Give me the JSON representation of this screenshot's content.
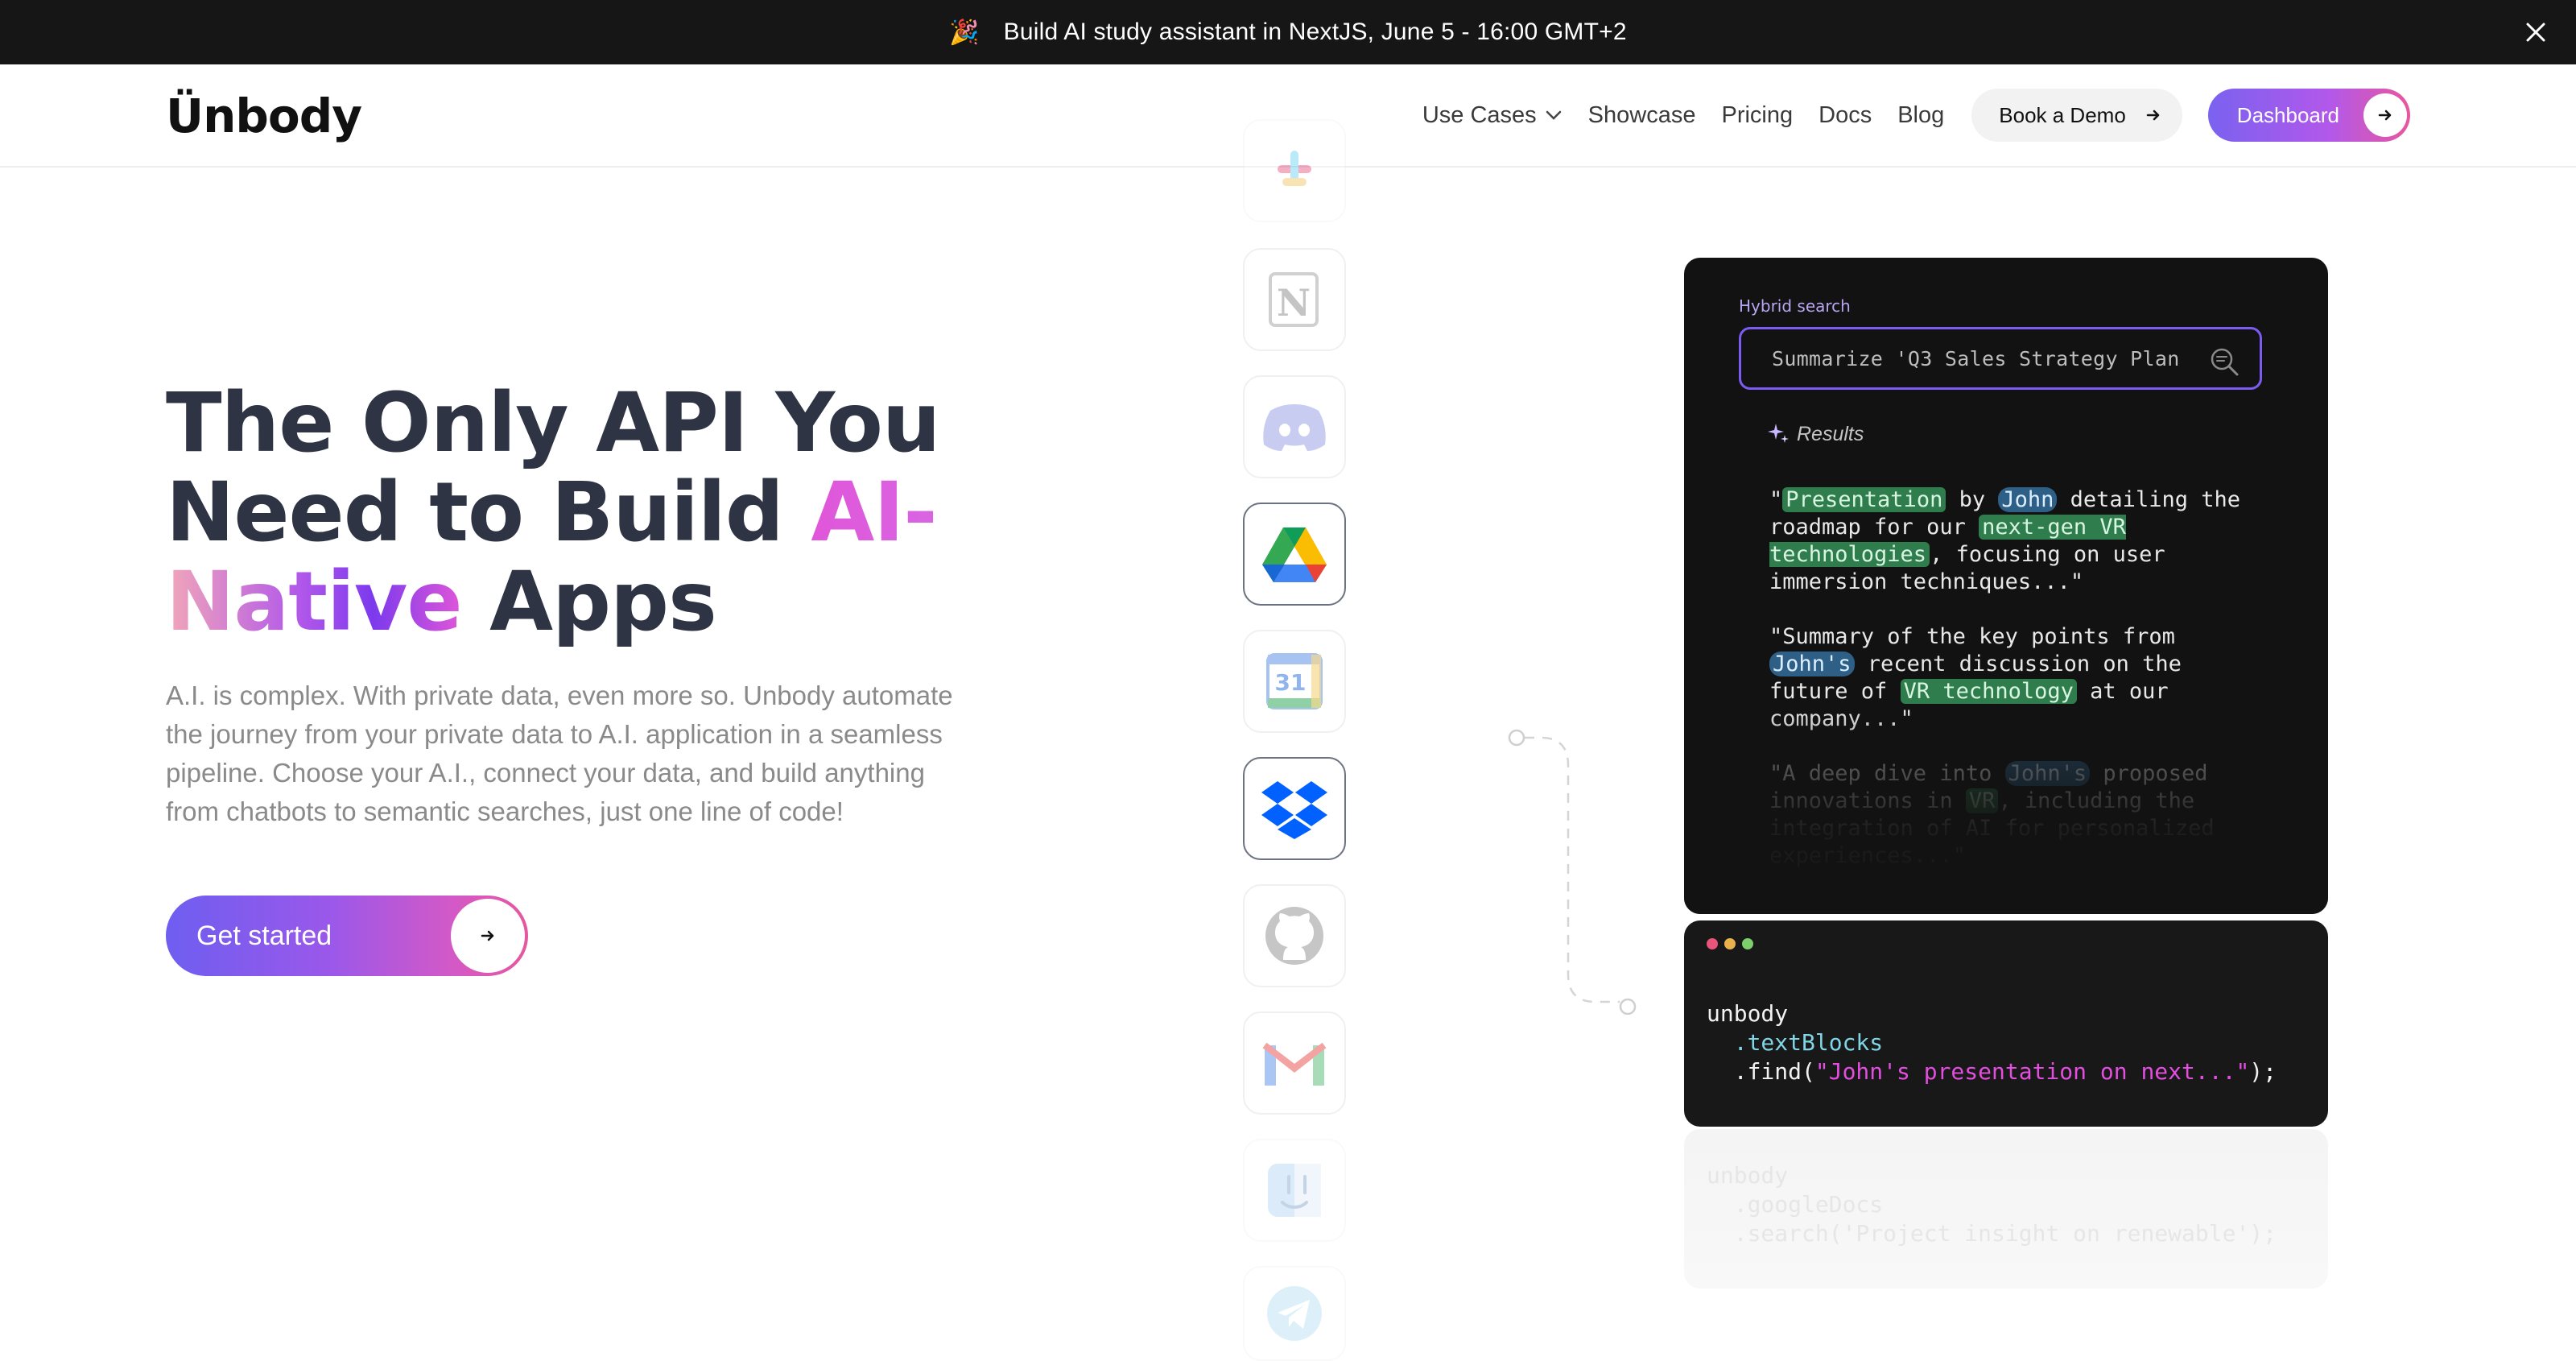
{
  "announcement": {
    "text": "Build AI study assistant in NextJS, June 5 - 16:00 GMT+2"
  },
  "header": {
    "logo": "Ünbody",
    "nav": [
      {
        "label": "Use Cases"
      },
      {
        "label": "Showcase"
      },
      {
        "label": "Pricing"
      },
      {
        "label": "Docs"
      },
      {
        "label": "Blog"
      }
    ],
    "book_demo_label": "Book a Demo",
    "dashboard_label": "Dashboard"
  },
  "hero": {
    "title_line1": "The Only API You",
    "title_line2_a": "Need to Build ",
    "title_line2_b": "AI-",
    "title_line3_a": "Native",
    "title_line3_b": " Apps",
    "description": "A.I. is complex. With private data, even more so. Unbody automate the journey from your private data to A.I. application in a seamless pipeline. Choose your A.I., connect your data, and build anything from chatbots to semantic searches, just one line of code!",
    "cta_label": "Get started"
  },
  "integrations": [
    {
      "name": "slack"
    },
    {
      "name": "notion"
    },
    {
      "name": "discord"
    },
    {
      "name": "google-drive"
    },
    {
      "name": "google-calendar"
    },
    {
      "name": "dropbox"
    },
    {
      "name": "github"
    },
    {
      "name": "gmail"
    },
    {
      "name": "finder"
    },
    {
      "name": "telegram"
    }
  ],
  "search_card": {
    "label": "Hybrid search",
    "query": "Summarize 'Q3 Sales Strategy Plan",
    "results_label": "Results",
    "results": [
      {
        "segments": [
          {
            "t": "\"",
            "h": ""
          },
          {
            "t": "Presentation",
            "h": "g"
          },
          {
            "t": " by ",
            "h": ""
          },
          {
            "t": "John",
            "h": "b"
          },
          {
            "t": " detailing the roadmap for our ",
            "h": ""
          },
          {
            "t": "next-gen VR technologies",
            "h": "g"
          },
          {
            "t": ", focusing on user immersion techniques...\"",
            "h": ""
          }
        ]
      },
      {
        "segments": [
          {
            "t": "\"Summary of the key points from ",
            "h": ""
          },
          {
            "t": "John's",
            "h": "b"
          },
          {
            "t": " recent discussion on the future of ",
            "h": ""
          },
          {
            "t": "VR technology",
            "h": "g"
          },
          {
            "t": " at our company...\"",
            "h": ""
          }
        ]
      },
      {
        "segments": [
          {
            "t": "\"A deep dive into ",
            "h": ""
          },
          {
            "t": "John's",
            "h": "b"
          },
          {
            "t": " proposed innovations in ",
            "h": ""
          },
          {
            "t": "VR",
            "h": "g"
          },
          {
            "t": ", including the integration of AI for personalized experiences...\"",
            "h": ""
          }
        ]
      }
    ]
  },
  "code_card": {
    "line1": "unbody",
    "line2": "  .textBlocks",
    "line3_a": "  .find(",
    "line3_b": "\"John's presentation on next...\"",
    "line3_c": ");"
  },
  "ghost_card": {
    "line1": "unbody",
    "line2": "  .googleDocs",
    "line3": "  .search('Project insight on renewable');"
  },
  "colors": {
    "accent_purple": "#7c5cf0",
    "accent_pink": "#e6579e",
    "dark_bg": "#121212"
  }
}
